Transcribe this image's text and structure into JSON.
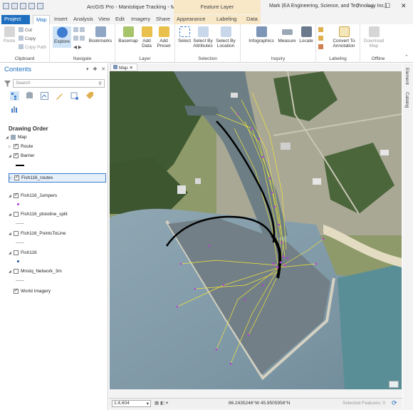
{
  "titlebar": {
    "title": "ArcGIS Pro - Manistique Tracking - Map",
    "context_group": "Feature Layer",
    "user": "Mark (EA Engineering, Science, and Technology Inc.)",
    "help": "?",
    "minimize": "—",
    "maximize": "☐",
    "close": "✕"
  },
  "tabs": [
    "Project",
    "Map",
    "Insert",
    "Analysis",
    "View",
    "Edit",
    "Imagery",
    "Share",
    "Appearance",
    "Labeling",
    "Data"
  ],
  "ribbon": {
    "clipboard": {
      "label": "Clipboard",
      "paste": "Paste",
      "cut": "Cut",
      "copy": "Copy",
      "copy_path": "Copy Path"
    },
    "navigate": {
      "label": "Navigate",
      "explore": "Explore",
      "bookmarks": "Bookmarks"
    },
    "layer": {
      "label": "Layer",
      "basemap": "Basemap",
      "add_data": "Add Data",
      "add_preset": "Add Preset"
    },
    "selection": {
      "label": "Selection",
      "select": "Select",
      "select_by_attributes": "Select By Attributes",
      "select_by_location": "Select By Location"
    },
    "inquiry": {
      "label": "Inquiry",
      "infographics": "Infographics",
      "measure": "Measure",
      "locate": "Locate"
    },
    "labeling": {
      "label": "Labeling",
      "convert": "Convert To Annotation"
    },
    "offline": {
      "label": "Offline",
      "download": "Download Map"
    }
  },
  "contents": {
    "title": "Contents",
    "search_placeholder": "Search",
    "drawing_order": "Drawing Order",
    "map_name": "Map",
    "layers": [
      {
        "name": "Route",
        "checked": true
      },
      {
        "name": "Barrier",
        "checked": true
      },
      {
        "name": "Fish116_routes",
        "checked": true
      },
      {
        "name": "Fish116_Jumpers",
        "checked": true
      },
      {
        "name": "Fish116_ptstoline_split",
        "checked": false
      },
      {
        "name": "Fish116_PointsToLine",
        "checked": false
      },
      {
        "name": "Fish116",
        "checked": false
      },
      {
        "name": "Mnstq_Network_3m",
        "checked": false
      },
      {
        "name": "World Imagery",
        "checked": true
      }
    ]
  },
  "map": {
    "tab": "Map",
    "scale": "1:4,604",
    "coordinates": "86.2435246°W 45.9505958°N",
    "selected_features": "Selected Features: 0"
  },
  "side_tabs": {
    "element": "Element",
    "catalog": "Catalog"
  },
  "colors": {
    "accent": "#1e6fbf",
    "route": "#f2e53a",
    "jumpers": "#b43ad6",
    "barrier": "#000000"
  }
}
